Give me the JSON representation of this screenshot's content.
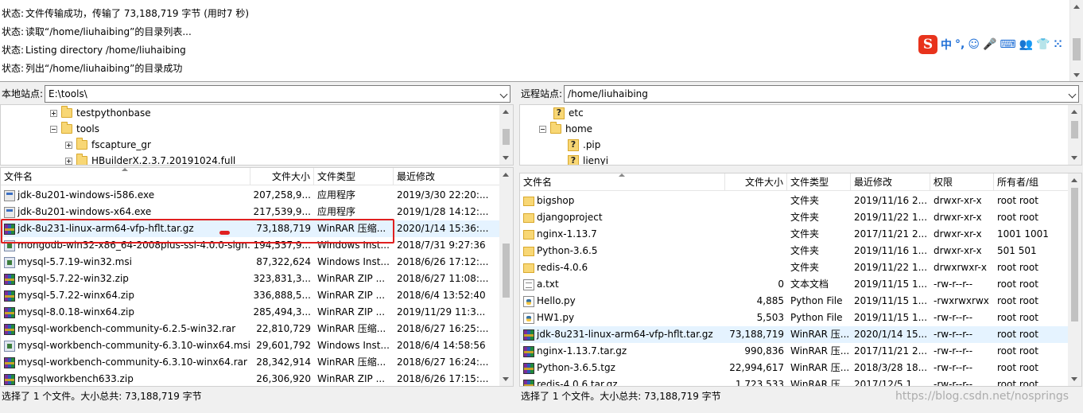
{
  "log": [
    {
      "label": "状态:",
      "text": "文件传输成功，传输了 73,188,719 字节 (用时7 秒)"
    },
    {
      "label": "状态:",
      "text": "读取“/home/liuhaibing”的目录列表..."
    },
    {
      "label": "状态:",
      "text": "Listing directory /home/liuhaibing"
    },
    {
      "label": "状态:",
      "text": "列出“/home/liuhaibing”的目录成功"
    }
  ],
  "ime": {
    "logo": "S",
    "items": [
      "中",
      "°,",
      "☺",
      "🎤",
      "⌨",
      "👥",
      "👕",
      "⁙"
    ]
  },
  "local": {
    "site_label": "本地站点:",
    "path": "E:\\tools\\",
    "tree": [
      {
        "name": "testpythonbase",
        "expander": "plus"
      },
      {
        "name": "tools",
        "expander": "minus"
      },
      {
        "name": "fscapture_gr",
        "expander": "plus"
      },
      {
        "name": "HBuilderX.2.3.7.20191024.full",
        "expander": "plus"
      }
    ],
    "headers": {
      "name": "文件名",
      "size": "文件大小",
      "type": "文件类型",
      "modified": "最近修改"
    },
    "files": [
      {
        "icon": "exe",
        "name": "jdk-8u201-windows-i586.exe",
        "size": "207,258,9...",
        "type": "应用程序",
        "modified": "2019/3/30 22:20:..."
      },
      {
        "icon": "exe",
        "name": "jdk-8u201-windows-x64.exe",
        "size": "217,539,9...",
        "type": "应用程序",
        "modified": "2019/1/28 14:12:..."
      },
      {
        "icon": "rar",
        "name": "jdk-8u231-linux-arm64-vfp-hflt.tar.gz",
        "size": "73,188,719",
        "type": "WinRAR 压缩...",
        "modified": "2020/1/14 15:36:...",
        "selected": true
      },
      {
        "icon": "msi",
        "name": "mongodb-win32-x86_64-2008plus-ssl-4.0.0-sign...",
        "size": "194,537,9...",
        "type": "Windows Inst...",
        "modified": "2018/7/31 9:27:36"
      },
      {
        "icon": "msi",
        "name": "mysql-5.7.19-win32.msi",
        "size": "87,322,624",
        "type": "Windows Inst...",
        "modified": "2018/6/26 17:12:..."
      },
      {
        "icon": "rar",
        "name": "mysql-5.7.22-win32.zip",
        "size": "323,831,3...",
        "type": "WinRAR ZIP ...",
        "modified": "2018/6/27 11:08:..."
      },
      {
        "icon": "rar",
        "name": "mysql-5.7.22-winx64.zip",
        "size": "336,888,5...",
        "type": "WinRAR ZIP ...",
        "modified": "2018/6/4 13:52:40"
      },
      {
        "icon": "rar",
        "name": "mysql-8.0.18-winx64.zip",
        "size": "285,494,3...",
        "type": "WinRAR ZIP ...",
        "modified": "2019/11/29 11:3..."
      },
      {
        "icon": "rar",
        "name": "mysql-workbench-community-6.2.5-win32.rar",
        "size": "22,810,729",
        "type": "WinRAR 压缩...",
        "modified": "2018/6/27 16:25:..."
      },
      {
        "icon": "msi",
        "name": "mysql-workbench-community-6.3.10-winx64.msi",
        "size": "29,601,792",
        "type": "Windows Inst...",
        "modified": "2018/6/4 14:58:56"
      },
      {
        "icon": "rar",
        "name": "mysql-workbench-community-6.3.10-winx64.rar",
        "size": "28,342,914",
        "type": "WinRAR 压缩...",
        "modified": "2018/6/27 16:24:..."
      },
      {
        "icon": "rar",
        "name": "mysqlworkbench633.zip",
        "size": "26,306,920",
        "type": "WinRAR ZIP ...",
        "modified": "2018/6/26 17:15:..."
      }
    ],
    "status": "选择了 1 个文件。大小总共: 73,188,719 字节"
  },
  "remote": {
    "site_label": "远程站点:",
    "path": "/home/liuhaibing",
    "tree": [
      {
        "name": "etc",
        "kind": "q"
      },
      {
        "name": "home",
        "kind": "folder"
      },
      {
        "name": ".pip",
        "kind": "q"
      },
      {
        "name": "lienyi",
        "kind": "q"
      }
    ],
    "headers": {
      "name": "文件名",
      "size": "文件大小",
      "type": "文件类型",
      "modified": "最近修改",
      "perm": "权限",
      "owner": "所有者/组"
    },
    "files": [
      {
        "icon": "folder",
        "name": "bigshop",
        "size": "",
        "type": "文件夹",
        "modified": "2019/11/16 2...",
        "perm": "drwxr-xr-x",
        "owner": "root root"
      },
      {
        "icon": "folder",
        "name": "djangoproject",
        "size": "",
        "type": "文件夹",
        "modified": "2019/11/22 1...",
        "perm": "drwxr-xr-x",
        "owner": "root root"
      },
      {
        "icon": "folder",
        "name": "nginx-1.13.7",
        "size": "",
        "type": "文件夹",
        "modified": "2017/11/21 2...",
        "perm": "drwxr-xr-x",
        "owner": "1001 1001"
      },
      {
        "icon": "folder",
        "name": "Python-3.6.5",
        "size": "",
        "type": "文件夹",
        "modified": "2019/11/16 1...",
        "perm": "drwxr-xr-x",
        "owner": "501 501"
      },
      {
        "icon": "folder",
        "name": "redis-4.0.6",
        "size": "",
        "type": "文件夹",
        "modified": "2019/11/22 1...",
        "perm": "drwxrwxr-x",
        "owner": "root root"
      },
      {
        "icon": "txt",
        "name": "a.txt",
        "size": "0",
        "type": "文本文档",
        "modified": "2019/11/15 1...",
        "perm": "-rw-r--r--",
        "owner": "root root"
      },
      {
        "icon": "py",
        "name": "Hello.py",
        "size": "4,885",
        "type": "Python File",
        "modified": "2019/11/15 1...",
        "perm": "-rwxrwxrwx",
        "owner": "root root"
      },
      {
        "icon": "py",
        "name": "HW1.py",
        "size": "5,503",
        "type": "Python File",
        "modified": "2019/11/15 1...",
        "perm": "-rw-r--r--",
        "owner": "root root"
      },
      {
        "icon": "rar",
        "name": "jdk-8u231-linux-arm64-vfp-hflt.tar.gz",
        "size": "73,188,719",
        "type": "WinRAR 压...",
        "modified": "2020/1/14 15...",
        "perm": "-rw-r--r--",
        "owner": "root root",
        "selected": true
      },
      {
        "icon": "rar",
        "name": "nginx-1.13.7.tar.gz",
        "size": "990,836",
        "type": "WinRAR 压...",
        "modified": "2017/11/21 2...",
        "perm": "-rw-r--r--",
        "owner": "root root"
      },
      {
        "icon": "rar",
        "name": "Python-3.6.5.tgz",
        "size": "22,994,617",
        "type": "WinRAR 压...",
        "modified": "2018/3/28 18...",
        "perm": "-rw-r--r--",
        "owner": "root root"
      },
      {
        "icon": "rar",
        "name": "redis-4.0.6.tar.gz",
        "size": "1,723,533",
        "type": "WinRAR 压...",
        "modified": "2017/12/5 1...",
        "perm": "-rw-r--r--",
        "owner": "root root"
      }
    ],
    "status": "选择了 1 个文件。大小总共: 73,188,719 字节"
  },
  "watermark": "https://blog.csdn.net/nosprings"
}
